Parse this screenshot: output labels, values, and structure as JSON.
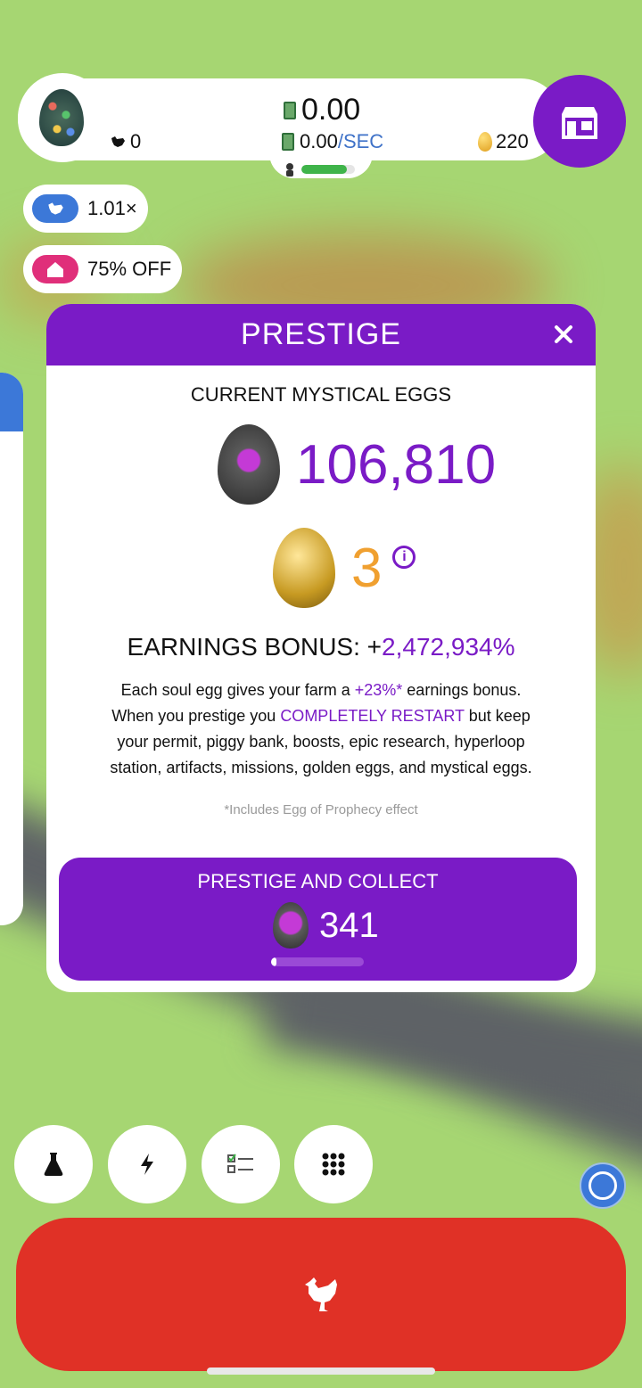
{
  "topbar": {
    "chicken_count": "0",
    "money": "0.00",
    "rate_value": "0.00",
    "rate_unit": "/SEC",
    "gold_eggs": "220",
    "farm_progress": 0.85
  },
  "boosts": {
    "chicken_multiplier": "1.01×",
    "discount": "75% OFF"
  },
  "modal": {
    "title": "PRESTIGE",
    "current_label": "CURRENT MYSTICAL EGGS",
    "soul_eggs": "106,810",
    "prophecy_eggs": "3",
    "earnings_label": "EARNINGS BONUS:",
    "earnings_prefix": "+",
    "earnings_value": "2,472,934%",
    "desc": {
      "l1a": "Each soul egg gives your farm a ",
      "l1b": "+23%*",
      "l1c": " earnings bonus.",
      "l2a": "When you prestige you ",
      "l2b": "COMPLETELY RESTART",
      "l2c": " but keep",
      "l3": "your permit, piggy bank, boosts, epic research, hyperloop",
      "l4": "station, artifacts, missions, golden eggs, and mystical eggs."
    },
    "footnote": "*Includes Egg of Prophecy effect",
    "collect_label": "PRESTIGE AND COLLECT",
    "collect_amount": "341",
    "collect_progress": 0.05
  },
  "colors": {
    "purple": "#7a1bc6",
    "hatch_red": "#e03126",
    "prophecy_orange": "#f0a030",
    "grass": "#a6d672"
  },
  "icons": [
    "chicken-icon",
    "cash-icon",
    "gold-egg-icon",
    "shop-icon",
    "home-icon",
    "close-icon",
    "info-icon",
    "flask-icon",
    "lightning-icon",
    "checklist-icon",
    "grid-icon",
    "circle-icon"
  ]
}
